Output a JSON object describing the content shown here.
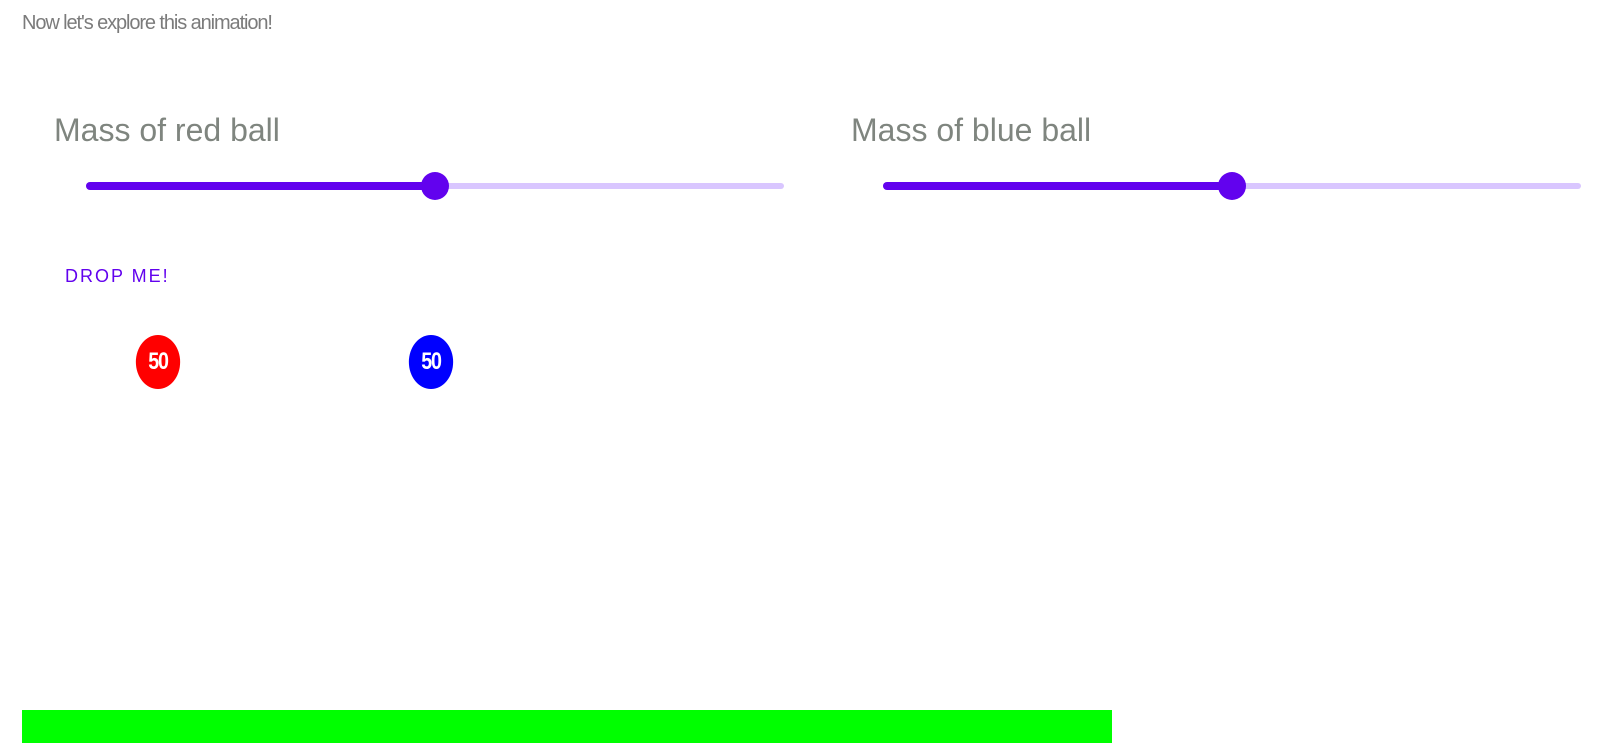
{
  "intro_text": "Now let's explore this animation!",
  "red_slider": {
    "label": "Mass of red ball",
    "value_fraction": 0.5
  },
  "blue_slider": {
    "label": "Mass of blue ball",
    "value_fraction": 0.5
  },
  "drop_button_label": "DROP ME!",
  "red_ball": {
    "mass_label": "50",
    "color": "#ff0000"
  },
  "blue_ball": {
    "mass_label": "50",
    "color": "#0000ff"
  },
  "ground_color": "#00ff00",
  "accent_color": "#6202ee",
  "track_color": "#d9c6ff"
}
